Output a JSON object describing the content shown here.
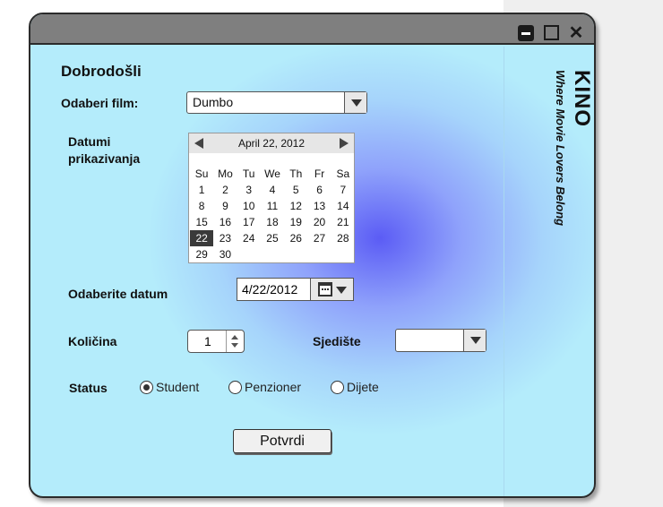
{
  "window": {
    "controls": [
      "minimize-icon",
      "maximize-icon",
      "close-icon"
    ],
    "close_glyph": "✕"
  },
  "brand": {
    "title": "KINO",
    "tagline": "Where Movie Lovers Belong"
  },
  "form": {
    "heading": "Dobrodošli",
    "film_label": "Odaberi film:",
    "film_value": "Dumbo",
    "dates_label_line1": "Datumi",
    "dates_label_line2": "prikazivanja",
    "choose_date_label": "Odaberite datum",
    "date_value": "4/22/2012",
    "quantity_label": "Količina",
    "quantity_value": "1",
    "seat_label": "Sjedište",
    "seat_value": "",
    "status_label": "Status",
    "status_options": [
      "Student",
      "Penzioner",
      "Dijete"
    ],
    "status_selected": "Student",
    "submit_label": "Potvrdi"
  },
  "calendar": {
    "month_label": "April 22, 2012",
    "weekdays": [
      "Su",
      "Mo",
      "Tu",
      "We",
      "Th",
      "Fr",
      "Sa"
    ],
    "weeks": [
      [
        "1",
        "2",
        "3",
        "4",
        "5",
        "6",
        "7"
      ],
      [
        "8",
        "9",
        "10",
        "11",
        "12",
        "13",
        "14"
      ],
      [
        "15",
        "16",
        "17",
        "18",
        "19",
        "20",
        "21"
      ],
      [
        "22",
        "23",
        "24",
        "25",
        "26",
        "27",
        "28"
      ],
      [
        "29",
        "30",
        "",
        "",
        "",
        "",
        ""
      ]
    ],
    "selected_day": "22"
  },
  "colors": {
    "accent": "#5b5cf5",
    "background": "#b4ecfb",
    "titlebar": "#7f7f7f"
  }
}
